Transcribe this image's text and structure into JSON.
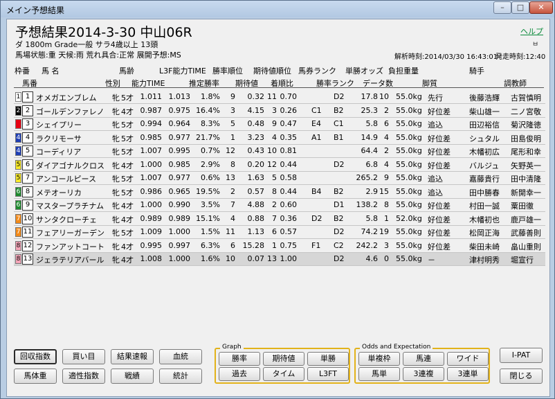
{
  "window": {
    "title": "メイン予想結果",
    "controls": {
      "minimize": "–",
      "maximize": "□",
      "close": "✕"
    }
  },
  "header": {
    "title": "予想結果2014-3-30 中山06R",
    "help": "ヘルプ",
    "race_info": "ダ 1800m Grade一般 サラ4歳以上 13頭",
    "conditions": "馬場状態:重 天候:雨 荒れ具合:正常 展開予想:MS",
    "pin_icon": "ㅂ",
    "analysis_time": "解析時刻:2014/03/30 16:43:01",
    "post_time": "発走時刻:12:40"
  },
  "columns": {
    "row1": [
      "枠番",
      "馬 名",
      "馬齢",
      "L3F能力TIME",
      "勝率順位",
      "期待値順位",
      "馬券ランク",
      "単勝オッズ",
      "負担重量",
      "騎手"
    ],
    "row2": [
      "馬番",
      "性別",
      "能力TIME",
      "推定勝率",
      "期待値",
      "着順比",
      "勝率ランク",
      "データ数",
      "脚質",
      "調教師"
    ]
  },
  "colors": {
    "waku1": "#ffffff",
    "waku2": "#000000",
    "waku3": "#e60012",
    "waku4": "#1e3eb4",
    "waku5": "#f6e82a",
    "waku6": "#1e8a2e",
    "waku7": "#f28a1a",
    "waku8": "#f4a5b8",
    "group_border": "#e2b21a",
    "help_link": "#0a8a3a"
  },
  "rows": [
    {
      "waku": "1",
      "num": "1",
      "name": "オメガエンブレム",
      "sex": "牝",
      "age": "5才",
      "time": "1.011",
      "l3f": "1.013",
      "rate": "1.8%",
      "rate_rank": "9",
      "exp": "0.32",
      "exp_rank": "11",
      "ratio": "0.70",
      "rank1": "",
      "rank2": "D2",
      "odds": "17.8",
      "data": "10",
      "weight": "55.0kg",
      "style": "先行",
      "jockey": "後藤浩輝",
      "trainer": "古賀慎明"
    },
    {
      "waku": "2",
      "num": "2",
      "name": "ゴールデンファレノ",
      "sex": "牝",
      "age": "4才",
      "time": "0.987",
      "l3f": "0.975",
      "rate": "16.4%",
      "rate_rank": "3",
      "exp": "4.15",
      "exp_rank": "3",
      "ratio": "0.26",
      "rank1": "C1",
      "rank2": "B2",
      "odds": "25.3",
      "data": "2",
      "weight": "55.0kg",
      "style": "好位差",
      "jockey": "柴山雄一",
      "trainer": "二ノ宮敬"
    },
    {
      "waku": "3",
      "num": "3",
      "name": "シェイプリー",
      "sex": "牝",
      "age": "5才",
      "time": "0.994",
      "l3f": "0.964",
      "rate": "8.3%",
      "rate_rank": "5",
      "exp": "0.48",
      "exp_rank": "9",
      "ratio": "0.47",
      "rank1": "E4",
      "rank2": "C1",
      "odds": "5.8",
      "data": "6",
      "weight": "55.0kg",
      "style": "追込",
      "jockey": "田辺裕信",
      "trainer": "菊沢隆徳"
    },
    {
      "waku": "4",
      "num": "4",
      "name": "ラクリモーサ",
      "sex": "牝",
      "age": "5才",
      "time": "0.985",
      "l3f": "0.977",
      "rate": "21.7%",
      "rate_rank": "1",
      "exp": "3.23",
      "exp_rank": "4",
      "ratio": "0.35",
      "rank1": "A1",
      "rank2": "B1",
      "odds": "14.9",
      "data": "4",
      "weight": "55.0kg",
      "style": "好位差",
      "jockey": "シュタル",
      "trainer": "田島俊明"
    },
    {
      "waku": "4",
      "num": "5",
      "name": "コーディリア",
      "sex": "牝",
      "age": "5才",
      "time": "1.007",
      "l3f": "0.995",
      "rate": "0.7%",
      "rate_rank": "12",
      "exp": "0.43",
      "exp_rank": "10",
      "ratio": "0.81",
      "rank1": "",
      "rank2": "",
      "odds": "64.4",
      "data": "2",
      "weight": "55.0kg",
      "style": "好位差",
      "jockey": "木幡初広",
      "trainer": "尾形和幸"
    },
    {
      "waku": "5",
      "num": "6",
      "name": "ダイアゴナルクロス",
      "sex": "牝",
      "age": "4才",
      "time": "1.000",
      "l3f": "0.985",
      "rate": "2.9%",
      "rate_rank": "8",
      "exp": "0.20",
      "exp_rank": "12",
      "ratio": "0.44",
      "rank1": "",
      "rank2": "D2",
      "odds": "6.8",
      "data": "4",
      "weight": "55.0kg",
      "style": "好位差",
      "jockey": "バルジュ",
      "trainer": "矢野英一"
    },
    {
      "waku": "5",
      "num": "7",
      "name": "アンコールピース",
      "sex": "牝",
      "age": "5才",
      "time": "1.007",
      "l3f": "0.977",
      "rate": "0.6%",
      "rate_rank": "13",
      "exp": "1.63",
      "exp_rank": "5",
      "ratio": "0.58",
      "rank1": "",
      "rank2": "",
      "odds": "265.2",
      "data": "9",
      "weight": "55.0kg",
      "style": "追込",
      "jockey": "嘉藤貴行",
      "trainer": "田中清隆"
    },
    {
      "waku": "6",
      "num": "8",
      "name": "メテオーリカ",
      "sex": "牝",
      "age": "5才",
      "time": "0.986",
      "l3f": "0.965",
      "rate": "19.5%",
      "rate_rank": "2",
      "exp": "0.57",
      "exp_rank": "8",
      "ratio": "0.44",
      "rank1": "B4",
      "rank2": "B2",
      "odds": "2.9",
      "data": "15",
      "weight": "55.0kg",
      "style": "追込",
      "jockey": "田中勝春",
      "trainer": "新開幸一"
    },
    {
      "waku": "6",
      "num": "9",
      "name": "マスタープラチナム",
      "sex": "牝",
      "age": "4才",
      "time": "1.000",
      "l3f": "0.990",
      "rate": "3.5%",
      "rate_rank": "7",
      "exp": "4.88",
      "exp_rank": "2",
      "ratio": "0.60",
      "rank1": "",
      "rank2": "D1",
      "odds": "138.2",
      "data": "8",
      "weight": "55.0kg",
      "style": "好位差",
      "jockey": "村田一誠",
      "trainer": "粟田徹"
    },
    {
      "waku": "7",
      "num": "10",
      "name": "サンタクローチェ",
      "sex": "牝",
      "age": "4才",
      "time": "0.989",
      "l3f": "0.989",
      "rate": "15.1%",
      "rate_rank": "4",
      "exp": "0.88",
      "exp_rank": "7",
      "ratio": "0.36",
      "rank1": "D2",
      "rank2": "B2",
      "odds": "5.8",
      "data": "1",
      "weight": "52.0kg",
      "style": "好位差",
      "jockey": "木幡初也",
      "trainer": "鹿戸雄一"
    },
    {
      "waku": "7",
      "num": "11",
      "name": "フェアリーガーデン",
      "sex": "牝",
      "age": "5才",
      "time": "1.009",
      "l3f": "1.000",
      "rate": "1.5%",
      "rate_rank": "11",
      "exp": "1.13",
      "exp_rank": "6",
      "ratio": "0.57",
      "rank1": "",
      "rank2": "D2",
      "odds": "74.2",
      "data": "19",
      "weight": "55.0kg",
      "style": "好位差",
      "jockey": "松岡正海",
      "trainer": "武藤善則"
    },
    {
      "waku": "8",
      "num": "12",
      "name": "ファンアットコート",
      "sex": "牝",
      "age": "4才",
      "time": "0.995",
      "l3f": "0.997",
      "rate": "6.3%",
      "rate_rank": "6",
      "exp": "15.28",
      "exp_rank": "1",
      "ratio": "0.75",
      "rank1": "F1",
      "rank2": "C2",
      "odds": "242.2",
      "data": "3",
      "weight": "55.0kg",
      "style": "好位差",
      "jockey": "柴田未崎",
      "trainer": "畠山重則"
    },
    {
      "waku": "8",
      "num": "13",
      "name": "ジェラテリアバール",
      "sex": "牝",
      "age": "4才",
      "time": "1.008",
      "l3f": "1.000",
      "rate": "1.6%",
      "rate_rank": "10",
      "exp": "0.07",
      "exp_rank": "13",
      "ratio": "1.00",
      "rank1": "",
      "rank2": "D2",
      "odds": "4.6",
      "data": "0",
      "weight": "55.0kg",
      "style": "－",
      "jockey": "津村明秀",
      "trainer": "堀宣行"
    }
  ],
  "buttons": {
    "left": [
      "回収指数",
      "買い目",
      "結果速報",
      "血統",
      "馬体重",
      "適性指数",
      "戦績",
      "統計"
    ],
    "graph_label": "Graph",
    "graph": [
      "勝率",
      "期待値",
      "単勝",
      "過去",
      "タイム",
      "L3FT"
    ],
    "odds_label": "Odds and Expectation",
    "odds": [
      "単複枠",
      "馬連",
      "ワイド",
      "馬単",
      "3連複",
      "3連単"
    ],
    "ipat": "I-PAT",
    "close": "閉じる"
  }
}
